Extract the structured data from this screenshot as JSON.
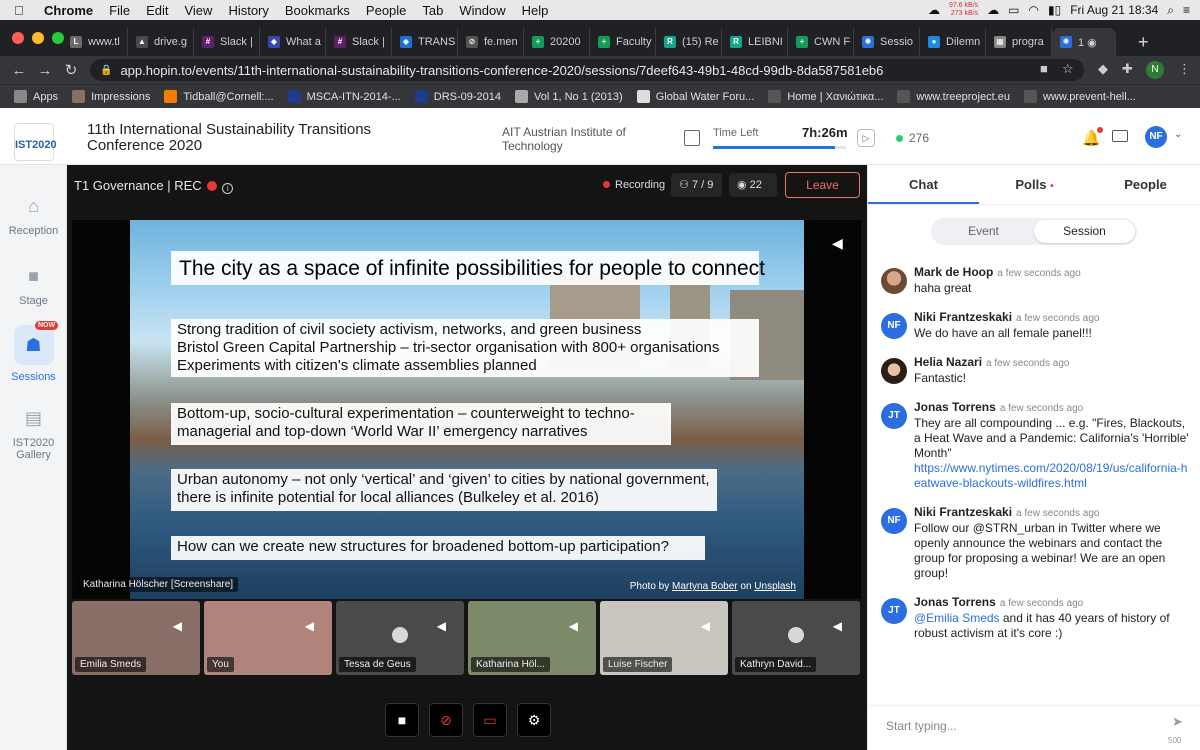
{
  "menubar": {
    "app": "Chrome",
    "items": [
      "File",
      "Edit",
      "View",
      "History",
      "Bookmarks",
      "People",
      "Tab",
      "Window",
      "Help"
    ],
    "net_up": "97.6 kB/s",
    "net_down": "273 kB/s",
    "clock": "Fri Aug 21  18:34"
  },
  "tabs": [
    {
      "label": "www.tl",
      "color": "#6b6b6b",
      "glyph": "L"
    },
    {
      "label": "drive.g",
      "color": "#4a4a4a",
      "glyph": "▲"
    },
    {
      "label": "Slack |",
      "color": "#611f69",
      "glyph": "#"
    },
    {
      "label": "What a",
      "color": "#3949ab",
      "glyph": "◆"
    },
    {
      "label": "Slack |",
      "color": "#611f69",
      "glyph": "#"
    },
    {
      "label": "TRANS",
      "color": "#1e6fd9",
      "glyph": "◆"
    },
    {
      "label": "fe.men",
      "color": "#555",
      "glyph": "⊘"
    },
    {
      "label": "20200",
      "color": "#0f9d58",
      "glyph": "+"
    },
    {
      "label": "Faculty",
      "color": "#0f9d58",
      "glyph": "+"
    },
    {
      "label": "(15) Re",
      "color": "#14a38b",
      "glyph": "R"
    },
    {
      "label": "LEIBNI",
      "color": "#14a38b",
      "glyph": "R"
    },
    {
      "label": "CWN F",
      "color": "#0f9d58",
      "glyph": "+"
    },
    {
      "label": "Sessio",
      "color": "#2b6ee0",
      "glyph": "✺"
    },
    {
      "label": "Dilemn",
      "color": "#1e88e5",
      "glyph": "●"
    },
    {
      "label": "progra",
      "color": "#888",
      "glyph": "▦"
    },
    {
      "label": "1 ◉",
      "color": "#2b6ee0",
      "glyph": "✺"
    }
  ],
  "toolbar": {
    "url": "app.hopin.to/events/11th-international-sustainability-transitions-conference-2020/sessions/7deef643-49b1-48cd-99db-8da587581eb6",
    "profile_initial": "N"
  },
  "bookmarks": [
    {
      "label": "Apps",
      "color": "#888"
    },
    {
      "label": "Impressions",
      "color": "#8d6e63"
    },
    {
      "label": "Tidball@Cornell:...",
      "color": "#f57c00"
    },
    {
      "label": "MSCA-ITN-2014-...",
      "color": "#1e3c8a"
    },
    {
      "label": "DRS-09-2014",
      "color": "#1e3c8a"
    },
    {
      "label": "Vol 1, No 1 (2013)",
      "color": "#aaa"
    },
    {
      "label": "Global Water Foru...",
      "color": "#ddd"
    },
    {
      "label": "Home | Χανιώτικα...",
      "color": "#555"
    },
    {
      "label": "www.treeproject.eu",
      "color": "#555"
    },
    {
      "label": "www.prevent-hell...",
      "color": "#555"
    }
  ],
  "header": {
    "logo_text": "IST2020",
    "conference_title": "11th International Sustainability Transitions Conference 2020",
    "organizer": "AIT Austrian Institute of Technology",
    "time_left_label": "Time Left",
    "time_left_value": "7h:26m",
    "time_progress": 0.92,
    "online_count": "276",
    "user_initials": "NF"
  },
  "leftnav": [
    {
      "label": "Reception",
      "icon": "home-icon"
    },
    {
      "label": "Stage",
      "icon": "camera-icon"
    },
    {
      "label": "Sessions",
      "icon": "people-icon",
      "badge": "NOW"
    },
    {
      "label": "IST2020 Gallery",
      "icon": "store-icon"
    }
  ],
  "stage": {
    "session_name": "T1 Governance | REC",
    "recording_label": "Recording",
    "participants": "7 / 9",
    "viewers": "22",
    "leave_label": "Leave",
    "speaker_label": "Katharina Hölscher [Screenshare]"
  },
  "slide": {
    "title": "The city as a space of infinite possibilities for people to connect",
    "box1": [
      "Strong tradition of civil society activism, networks, and green business",
      "Bristol Green Capital Partnership – tri-sector organisation with 800+ organisations",
      "Experiments with citizen's climate assemblies planned"
    ],
    "box2": "Bottom-up, socio-cultural experimentation – counterweight to techno-managerial and top-down ‘World War II’ emergency narratives",
    "box3": "Urban autonomy – not only ‘vertical’ and ‘given’ to cities by national government, there is infinite potential for local alliances (Bulkeley et al. 2016)",
    "box4": "How can we create new structures for broadened bottom-up participation?",
    "credit_prefix": "Photo by",
    "credit_author": "Martyna Bober",
    "credit_mid": "on",
    "credit_site": "Unsplash"
  },
  "participants": [
    {
      "name": "Emilia Smeds",
      "bg": "#8a6f68"
    },
    {
      "name": "You",
      "bg": "#b0847a"
    },
    {
      "name": "Tessa de Geus",
      "bg": "#4a4a4a"
    },
    {
      "name": "Katharina Höl...",
      "bg": "#7d8a6a"
    },
    {
      "name": "Luise Fischer",
      "bg": "#c9c6bf"
    },
    {
      "name": "Kathryn David...",
      "bg": "#4a4a4a"
    }
  ],
  "panel": {
    "tabs": [
      "Chat",
      "Polls",
      "People"
    ],
    "segments": [
      "Event",
      "Session"
    ],
    "composer_placeholder": "Start typing...",
    "char_limit": "500",
    "messages": [
      {
        "initials": "",
        "avatar": "photo1",
        "name": "Mark de Hoop",
        "time": "a few seconds ago",
        "text": "haha great"
      },
      {
        "initials": "NF",
        "avatar": "",
        "name": "Niki Frantzeskaki",
        "time": "a few seconds ago",
        "text": "We do have an all female panel!!!"
      },
      {
        "initials": "",
        "avatar": "photo2",
        "name": "Helia Nazari",
        "time": "a few seconds ago",
        "text": "Fantastic!"
      },
      {
        "initials": "JT",
        "avatar": "",
        "name": "Jonas Torrens",
        "time": "a few seconds ago",
        "text": "They are all compounding ... e.g. \"Fires, Blackouts, a Heat Wave and a Pandemic: California's 'Horrible' Month\"",
        "link": "https://www.nytimes.com/2020/08/19/us/california-heatwave-blackouts-wildfires.html"
      },
      {
        "initials": "NF",
        "avatar": "",
        "name": "Niki Frantzeskaki",
        "time": "a few seconds ago",
        "text": "Follow our @STRN_urban in Twitter where we openly announce the webinars and contact the group for proposing a webinar! We are an open group!"
      },
      {
        "initials": "JT",
        "avatar": "",
        "name": "Jonas Torrens",
        "time": "a few seconds ago",
        "mention": "@Emilia Smeds",
        "text": " and it has 40 years of history of robust activism at it's core :)"
      }
    ]
  },
  "colors": {
    "accent": "#2b6ee0",
    "recording": "#e53935",
    "leave": "#ef6c6c",
    "online": "#2ecc71"
  }
}
